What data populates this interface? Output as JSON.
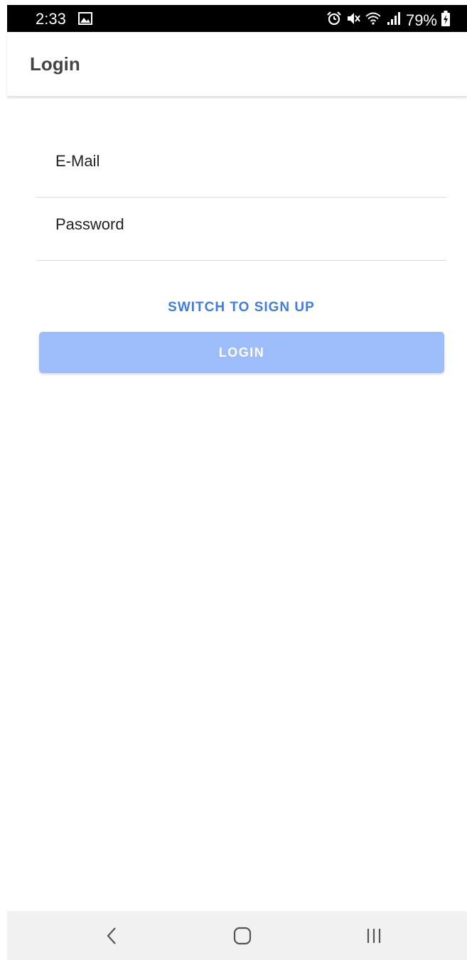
{
  "status_bar": {
    "time": "2:33",
    "battery": "79%",
    "icons": [
      "gallery-icon",
      "alarm-icon",
      "mute-icon",
      "wifi-icon",
      "signal-icon",
      "battery-charging-icon"
    ]
  },
  "app_bar": {
    "title": "Login"
  },
  "form": {
    "email_placeholder": "E-Mail",
    "password_placeholder": "Password",
    "switch_label": "SWITCH TO SIGN UP",
    "login_label": "LOGIN"
  },
  "nav_bar": {
    "icons": [
      "back-icon",
      "home-icon",
      "recent-apps-icon"
    ]
  },
  "colors": {
    "accent": "#3f7ee0",
    "login_button": "#9dbcfa",
    "status_bar": "#000000",
    "nav_bar": "#f1f1f1"
  }
}
